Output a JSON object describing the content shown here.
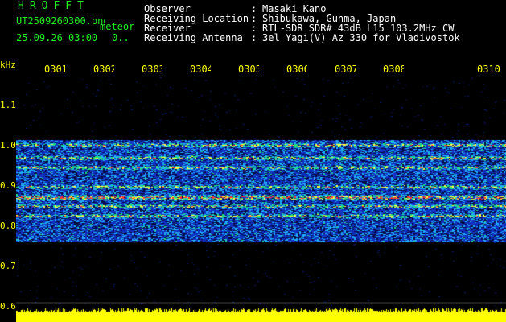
{
  "app": {
    "name": "HROFFT"
  },
  "file": {
    "name": "UT2509260300.png",
    "mode": "meteor",
    "datetime": "25.09.26 03:00",
    "count": "0.."
  },
  "info": [
    {
      "label": "Observer",
      "sep": ":",
      "value": "Masaki Kano"
    },
    {
      "label": "Receiving Location",
      "sep": ":",
      "value": "Shibukawa, Gunma, Japan"
    },
    {
      "label": "Receiver",
      "sep": ":",
      "value": "RTL-SDR SDR# 43dB L15 103.2MHz CW"
    },
    {
      "label": "Receiving Antenna",
      "sep": ":",
      "value": "3el Yagi(V) Az 330 for Vladivostok"
    }
  ],
  "x_ticks": [
    "0301",
    "0302",
    "0303",
    "0304",
    "0305",
    "0306",
    "0307",
    "0308",
    "0310"
  ],
  "y_unit": "kHz",
  "y_ticks": [
    "1.1",
    "1.0",
    "0.9",
    "0.8",
    "0.7",
    "0.6"
  ],
  "colors": {
    "label": "#ffff00",
    "header": "#ffffff",
    "logo": "#22ee22",
    "background": "#000000",
    "signal": "#ffff00"
  }
}
